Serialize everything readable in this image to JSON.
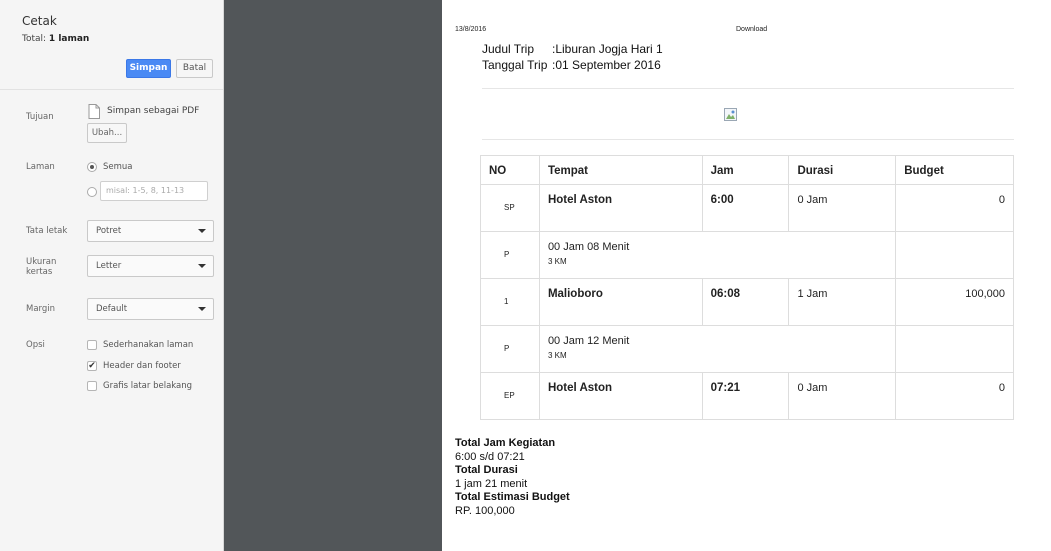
{
  "sidebar": {
    "title": "Cetak",
    "total_prefix": "Total: ",
    "total_value": "1 laman",
    "save_label": "Simpan",
    "cancel_label": "Batal",
    "destination": {
      "label": "Tujuan",
      "value": "Simpan sebagai PDF",
      "change_label": "Ubah..."
    },
    "pages": {
      "label": "Laman",
      "all_label": "Semua",
      "range_placeholder": "misal: 1-5, 8, 11-13"
    },
    "layout": {
      "label": "Tata letak",
      "value": "Potret"
    },
    "paper": {
      "label": "Ukuran kertas",
      "value": "Letter"
    },
    "margin": {
      "label": "Margin",
      "value": "Default"
    },
    "options": {
      "label": "Opsi",
      "items": [
        {
          "label": "Sederhanakan laman",
          "checked": false
        },
        {
          "label": "Header dan footer",
          "checked": true
        },
        {
          "label": "Grafis latar belakang",
          "checked": false
        }
      ]
    }
  },
  "preview": {
    "header_date": "13/8/2016",
    "header_title": "Download",
    "trip_name_label": "Judul Trip",
    "trip_name_value": ":Liburan Jogja Hari 1",
    "trip_date_label": "Tanggal Trip",
    "trip_date_value": ":01 September 2016",
    "table": {
      "headers": [
        "NO",
        "Tempat",
        "Jam",
        "Durasi",
        "Budget"
      ],
      "rows": [
        {
          "no": "SP",
          "tempat": "Hotel Aston",
          "jam": "6:00",
          "durasi": "0 Jam",
          "budget": "0"
        },
        {
          "no": "P",
          "travel": "00 Jam 08 Menit",
          "distance": "3 KM"
        },
        {
          "no": "1",
          "tempat": "Malioboro",
          "jam": "06:08",
          "durasi": "1 Jam",
          "budget": "100,000"
        },
        {
          "no": "P",
          "travel": "00 Jam 12 Menit",
          "distance": "3 KM"
        },
        {
          "no": "EP",
          "tempat": "Hotel Aston",
          "jam": "07:21",
          "durasi": "0 Jam",
          "budget": "0"
        }
      ]
    },
    "summary": {
      "activity_label": "Total Jam Kegiatan",
      "activity_value": "6:00 s/d 07:21",
      "duration_label": "Total Durasi",
      "duration_value": "1 jam 21 menit",
      "budget_label": "Total Estimasi Budget",
      "budget_value": "RP. 100,000"
    }
  }
}
